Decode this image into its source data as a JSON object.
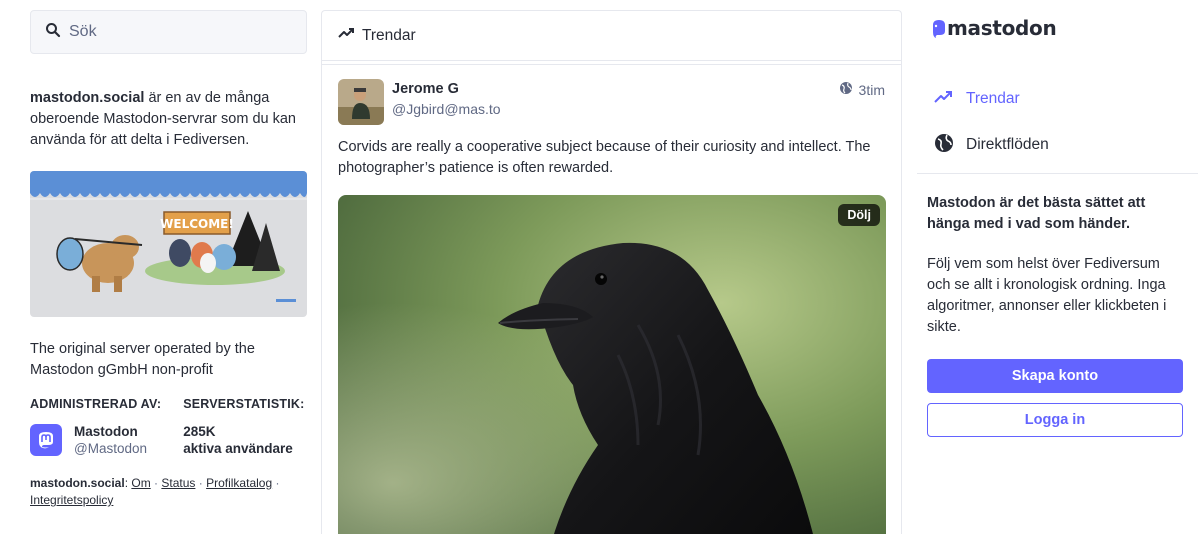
{
  "search": {
    "placeholder": "Sök"
  },
  "about": {
    "server": "mastodon.social",
    "text": " är en av de många oberoende Mastodon-servrar som du kan använda för att delta i Fediversen."
  },
  "hero": {
    "sign": "WELCOME!"
  },
  "description": "The original server operated by the Mastodon gGmbH non-profit",
  "admin": {
    "heading": "ADMINISTRERAD AV:",
    "name": "Mastodon",
    "handle": "@Mastodon"
  },
  "stats": {
    "heading": "SERVERSTATISTIK:",
    "value": "285K",
    "label": "aktiva användare"
  },
  "footer": {
    "server": "mastodon.social",
    "sep": ":",
    "links": [
      "Om",
      "Status",
      "Profilkatalog",
      "Integritetspolicy"
    ],
    "dot": " · "
  },
  "column": {
    "title": "Trendar"
  },
  "post": {
    "author": "Jerome G",
    "handle": "@Jgbird@mas.to",
    "time": "3tim",
    "text": "Corvids are really a cooperative subject because of their curiosity and intellect. The photographer’s patience is often rewarded.",
    "hide_label": "Dölj"
  },
  "brand": {
    "word": "mastodon",
    "color": "#6364ff"
  },
  "nav": {
    "items": [
      {
        "label": "Trendar",
        "icon": "trending-icon",
        "active": true
      },
      {
        "label": "Direktflöden",
        "icon": "globe-icon",
        "active": false
      }
    ]
  },
  "promo": {
    "title": "Mastodon är det bästa sättet att hänga med i vad som händer.",
    "body": "Följ vem som helst över Fediversum och se allt i kronologisk ordning. Inga algoritmer, annonser eller klickbeten i sikte."
  },
  "buttons": {
    "create": "Skapa konto",
    "login": "Logga in"
  }
}
